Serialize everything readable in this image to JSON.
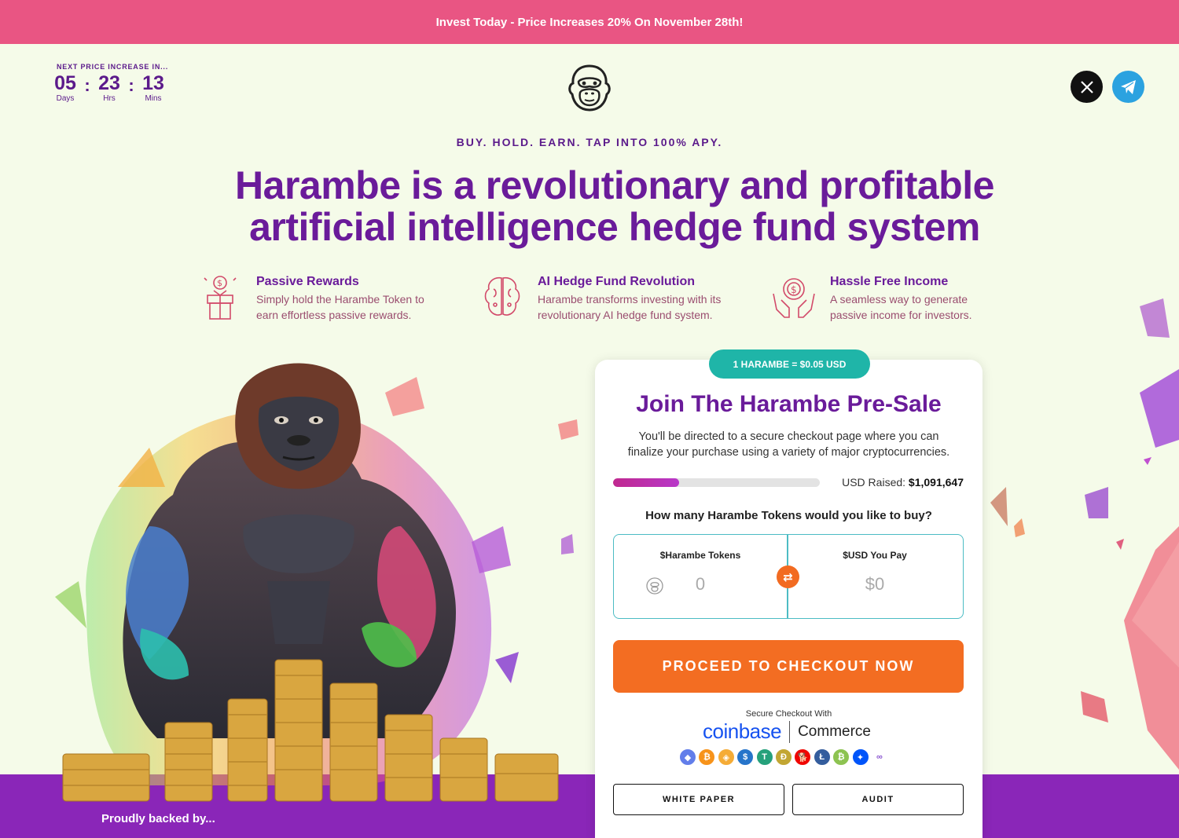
{
  "banner": {
    "text": "Invest Today - Price Increases 20% On November 28th!"
  },
  "countdown": {
    "label": "NEXT PRICE INCREASE IN...",
    "days": "05",
    "days_label": "Days",
    "hours": "23",
    "hours_label": "Hrs",
    "mins": "13",
    "mins_label": "Mins",
    "separator": ":"
  },
  "header": {
    "logo_icon": "gorilla-logo-icon",
    "social": [
      {
        "name": "x-icon",
        "color": "#111111"
      },
      {
        "name": "telegram-icon",
        "color": "#2ba2e0"
      }
    ]
  },
  "hero": {
    "tagline": "BUY. HOLD. EARN. TAP INTO 100% APY.",
    "headline": "Harambe is a revolutionary and profitable artificial intelligence hedge fund system"
  },
  "features": [
    {
      "icon": "gift-dollar-icon",
      "title": "Passive Rewards",
      "desc_line1": "Simply hold the Harambe Token to",
      "desc_line2": "earn effortless passive rewards."
    },
    {
      "icon": "brain-circuit-icon",
      "title": "AI Hedge Fund Revolution",
      "desc_line1": "Harambe transforms investing with its",
      "desc_line2": "revolutionary AI hedge fund system."
    },
    {
      "icon": "hands-coin-icon",
      "title": "Hassle Free Income",
      "desc_line1": "A seamless way to generate",
      "desc_line2": "passive income for investors."
    }
  ],
  "presale": {
    "price_pill": "1 HARAMBE = $0.05 USD",
    "title": "Join The Harambe Pre-Sale",
    "desc": "You'll be directed to a secure checkout page where you can finalize your purchase using a variety of major cryptocurrencies.",
    "progress_fraction": 0.32,
    "raised_label": "USD Raised:",
    "raised_value": "$1,091,647",
    "question": "How many Harambe Tokens would you like to buy?",
    "tokens_label": "$Harambe Tokens",
    "tokens_value": "0",
    "usd_label": "$USD You Pay",
    "usd_value": "$0",
    "checkout_label": "PROCEED TO CHECKOUT NOW",
    "secure_label": "Secure Checkout With",
    "coinbase_word": "coinbase",
    "commerce_word": "Commerce",
    "white_paper_label": "WHITE PAPER",
    "audit_label": "AUDIT"
  },
  "payment_coins": [
    {
      "name": "ethereum-icon",
      "glyph": "◆",
      "color": "#627eea"
    },
    {
      "name": "bitcoin-icon",
      "glyph": "₿",
      "color": "#f7931a"
    },
    {
      "name": "dai-icon",
      "glyph": "◈",
      "color": "#f5ac37"
    },
    {
      "name": "usdc-icon",
      "glyph": "$",
      "color": "#2775ca"
    },
    {
      "name": "tether-icon",
      "glyph": "T",
      "color": "#26a17b"
    },
    {
      "name": "dogecoin-icon",
      "glyph": "Ð",
      "color": "#c2a633"
    },
    {
      "name": "shiba-inu-icon",
      "glyph": "🐕",
      "color": "#f00500"
    },
    {
      "name": "litecoin-icon",
      "glyph": "Ł",
      "color": "#345d9d"
    },
    {
      "name": "bitcoin-cash-icon",
      "glyph": "₿",
      "color": "#8dc351"
    },
    {
      "name": "apecoin-icon",
      "glyph": "✦",
      "color": "#0054fa"
    },
    {
      "name": "chainlink-icon",
      "glyph": "∞",
      "color": "#ffffff"
    }
  ],
  "footer": {
    "backed_label": "Proudly backed by..."
  }
}
